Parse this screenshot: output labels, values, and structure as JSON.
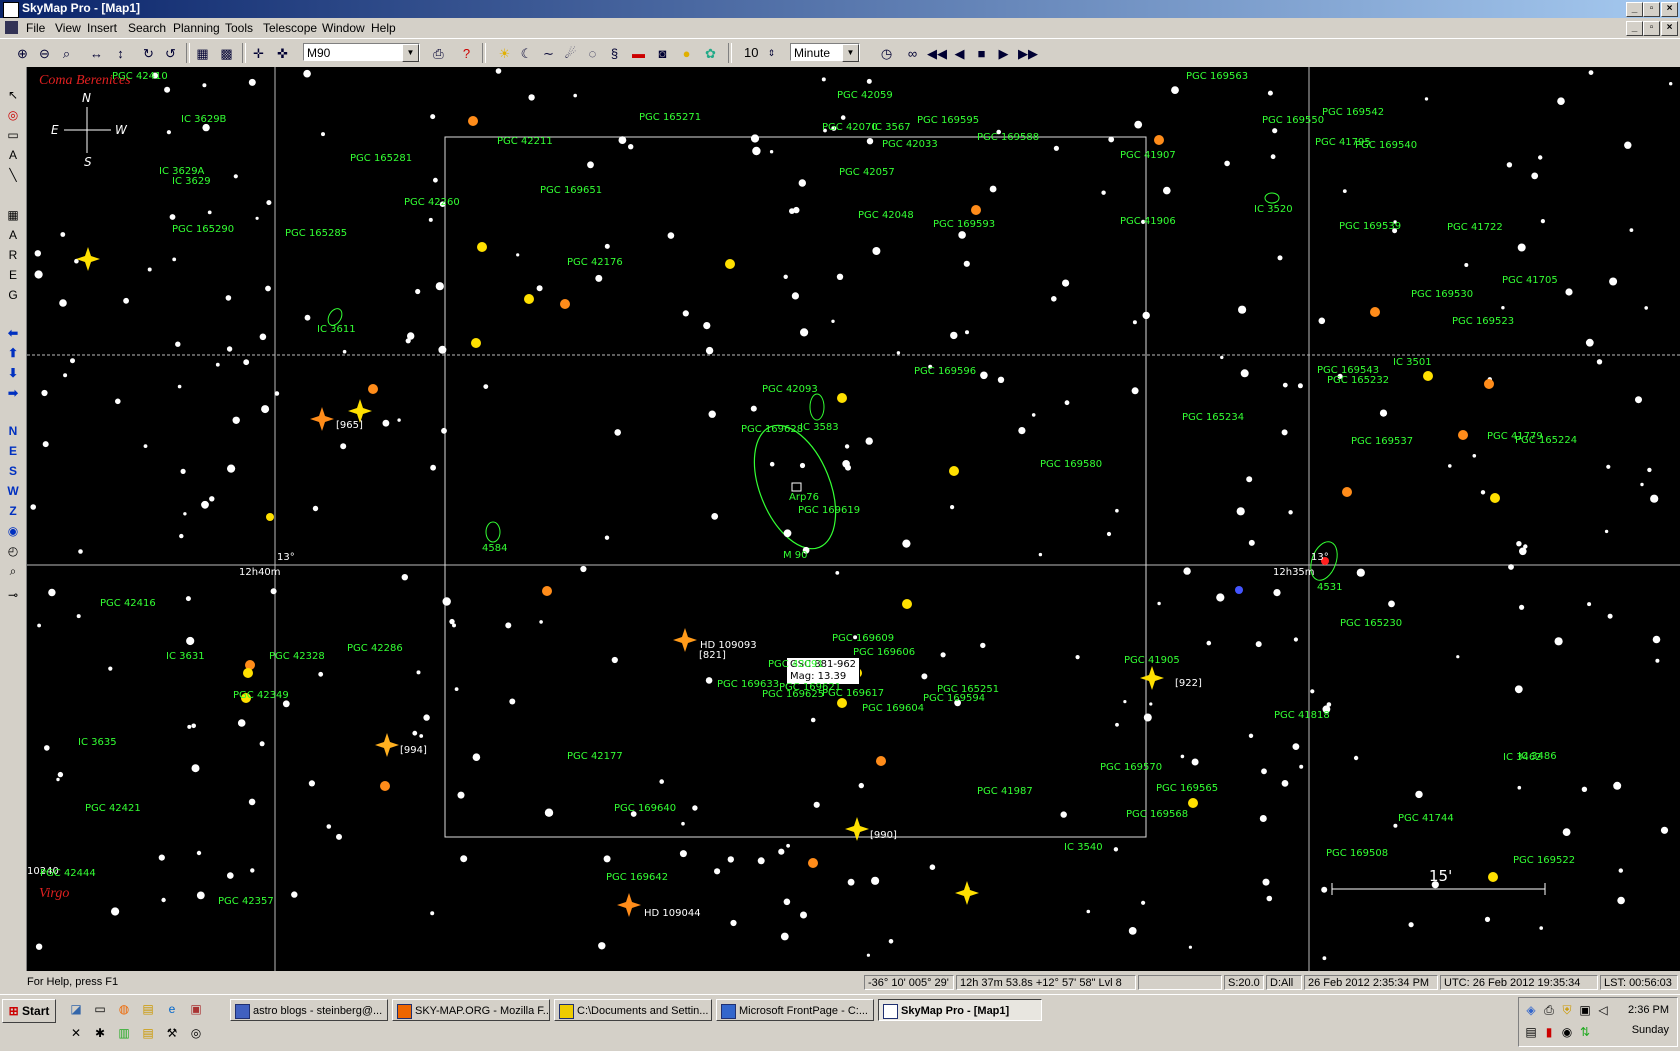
{
  "window": {
    "title": "SkyMap Pro - [Map1]"
  },
  "menu": [
    "File",
    "View",
    "Insert",
    "Search",
    "Planning",
    "Tools",
    "Telescope",
    "Window",
    "Help"
  ],
  "toolbar": {
    "object_combo": "M90",
    "time_step_value": "10",
    "time_unit": "Minute"
  },
  "left_tools": {
    "direction_buttons": [
      "N",
      "E",
      "S",
      "W",
      "Z"
    ],
    "letter_buttons": [
      "A",
      "R",
      "E",
      "G"
    ]
  },
  "map": {
    "constellations": {
      "top_left": "Coma Berenices",
      "bottom_left": "Virgo"
    },
    "compass": {
      "n": "N",
      "e": "E",
      "w": "W",
      "s": "S"
    },
    "grid_labels": {
      "dec_left": "13°",
      "ra_left": "12h40m",
      "dec_right": "13°",
      "ra_right": "12h35m",
      "bottom_left": "10240"
    },
    "scale_bar": "15'",
    "tooltip": {
      "line1": "GSC 881-962",
      "line2": "Mag: 13.39"
    },
    "object_labels": [
      "PGC 42410",
      "IC 3629B",
      "IC 3629A",
      "IC 3629",
      "PGC 165290",
      "PGC 165281",
      "PGC 165285",
      "PGC 42260",
      "IC 3611",
      "PGC 42211",
      "PGC 169651",
      "PGC 165271",
      "PGC 42176",
      "PGC 42059",
      "PGC 42070",
      "IC 3567",
      "PGC 169595",
      "PGC 169588",
      "PGC 42033",
      "PGC 42057",
      "PGC 42048",
      "PGC 169593",
      "PGC 41907",
      "PGC 41906",
      "PGC 169563",
      "PGC 169550",
      "PGC 169542",
      "PGC 41795",
      "PGC 169540",
      "IC 3520",
      "PGC 169539",
      "PGC 41722",
      "PGC 41705",
      "PGC 169530",
      "PGC 169523",
      "IC 3501",
      "PGC 169543",
      "PGC 165232",
      "PGC 169596",
      "PGC 42093",
      "IC 3583",
      "PGC 169628",
      "Arp76",
      "PGC 169619",
      "M 90",
      "4584",
      "PGC 165234",
      "PGC 169580",
      "PGC 169537",
      "PGC 41779",
      "PGC 165224",
      "4531",
      "PGC 165230",
      "PGC 42416",
      "IC 3631",
      "PGC 42328",
      "PGC 42286",
      "PGC 42349",
      "IC 3635",
      "PGC 42421",
      "PGC 42444",
      "PGC 42357",
      "PGC 169609",
      "PGC 169606",
      "PGC 42091",
      "PGC 169633",
      "PGC 169621",
      "PGC 169625",
      "PGC 169617",
      "PGC 169604",
      "PGC 165251",
      "PGC 169594",
      "PGC 41905",
      "PGC 41818",
      "PGC 42177",
      "PGC 169640",
      "PGC 169642",
      "PGC 41987",
      "PGC 169570",
      "PGC 169565",
      "PGC 169568",
      "IC 3540",
      "PGC 41744",
      "IC 3486",
      "IC 3462",
      "PGC 169508",
      "PGC 169522"
    ],
    "star_labels": [
      "[965]",
      "[994]",
      "[821]",
      "HD 109093",
      "[922]",
      "[990]",
      "HD 109044"
    ]
  },
  "status": {
    "help": "For Help, press F1",
    "alt_az": "-36° 10'  005° 29'",
    "coords": "12h 37m 53.8s  +12° 57' 58\"  Lvl 8",
    "scale": "S:20.0",
    "filter": "D:All",
    "local_time": "26 Feb 2012 2:35:34 PM",
    "utc": "UTC: 26 Feb 2012 19:35:34",
    "lst": "LST: 00:56:03"
  },
  "taskbar": {
    "start": "Start",
    "tasks": [
      "astro blogs - steinberg@...",
      "SKY-MAP.ORG - Mozilla F...",
      "C:\\Documents and Settin...",
      "Microsoft FrontPage - C:...",
      "SkyMap Pro - [Map1]"
    ],
    "clock_time": "2:36 PM",
    "clock_day": "Sunday"
  },
  "colors": {
    "galaxy": "#33ff33",
    "constellation": "#e02020",
    "sky": "#000000"
  }
}
